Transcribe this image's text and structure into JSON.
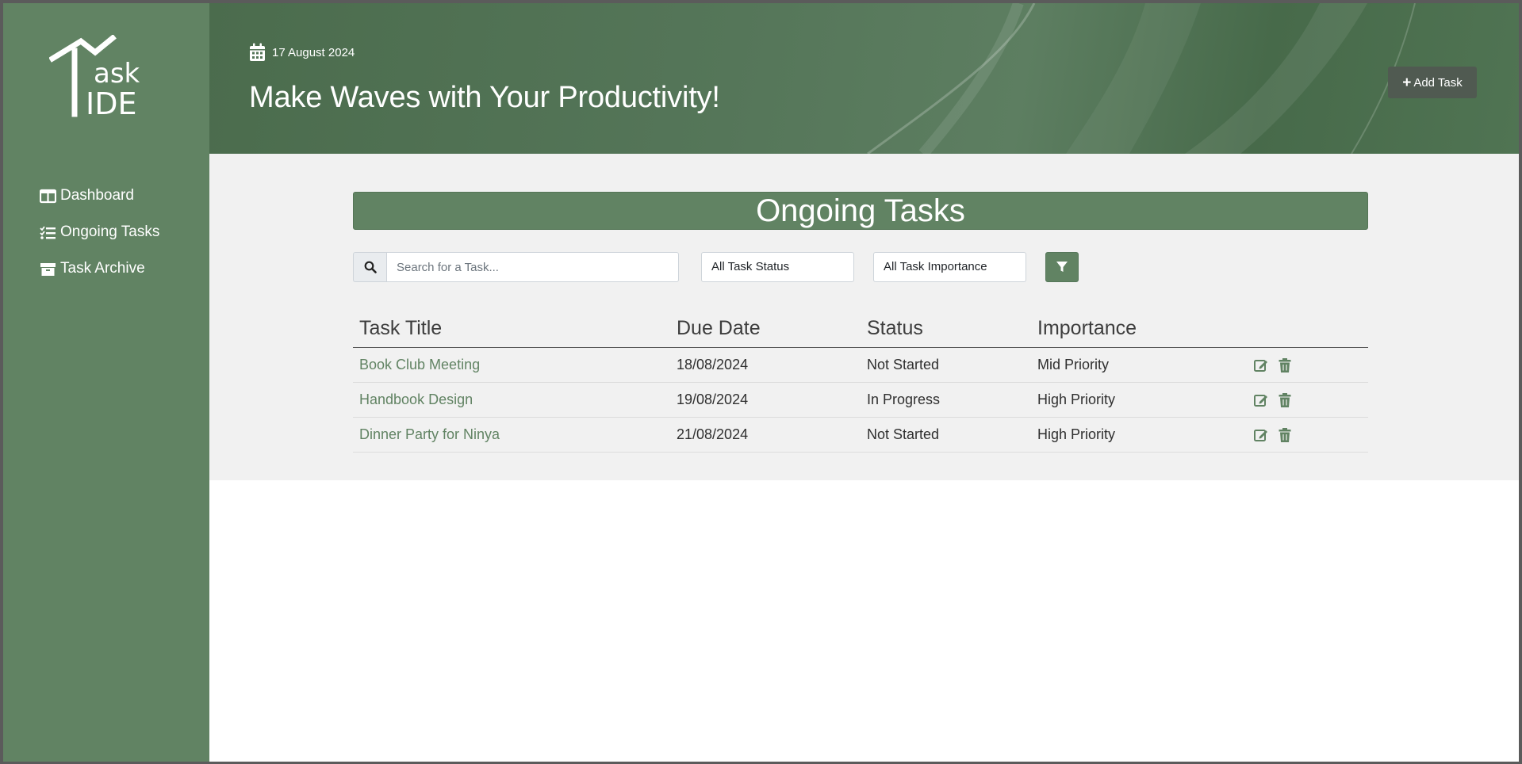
{
  "sidebar": {
    "logo_text_top": "ask",
    "logo_text_bottom": "IDE",
    "nav": [
      {
        "label": "Dashboard",
        "icon": "columns-icon"
      },
      {
        "label": "Ongoing Tasks",
        "icon": "tasks-icon"
      },
      {
        "label": "Task Archive",
        "icon": "archive-icon"
      }
    ]
  },
  "header": {
    "date": "17 August 2024",
    "headline": "Make Waves with Your Productivity!",
    "add_task_label": "Add Task"
  },
  "main": {
    "section_title": "Ongoing Tasks",
    "search_placeholder": "Search for a Task...",
    "status_filter": "All Task Status",
    "importance_filter": "All Task Importance",
    "columns": [
      "Task Title",
      "Due Date",
      "Status",
      "Importance"
    ],
    "rows": [
      {
        "title": "Book Club Meeting",
        "due": "18/08/2024",
        "status": "Not Started",
        "importance": "Mid Priority"
      },
      {
        "title": "Handbook Design",
        "due": "19/08/2024",
        "status": "In Progress",
        "importance": "High Priority"
      },
      {
        "title": "Dinner Party for Ninya",
        "due": "21/08/2024",
        "status": "Not Started",
        "importance": "High Priority"
      }
    ]
  },
  "colors": {
    "sidebar": "#618363",
    "header": "#557659",
    "accent": "#618363",
    "dark_button": "#505a51"
  }
}
